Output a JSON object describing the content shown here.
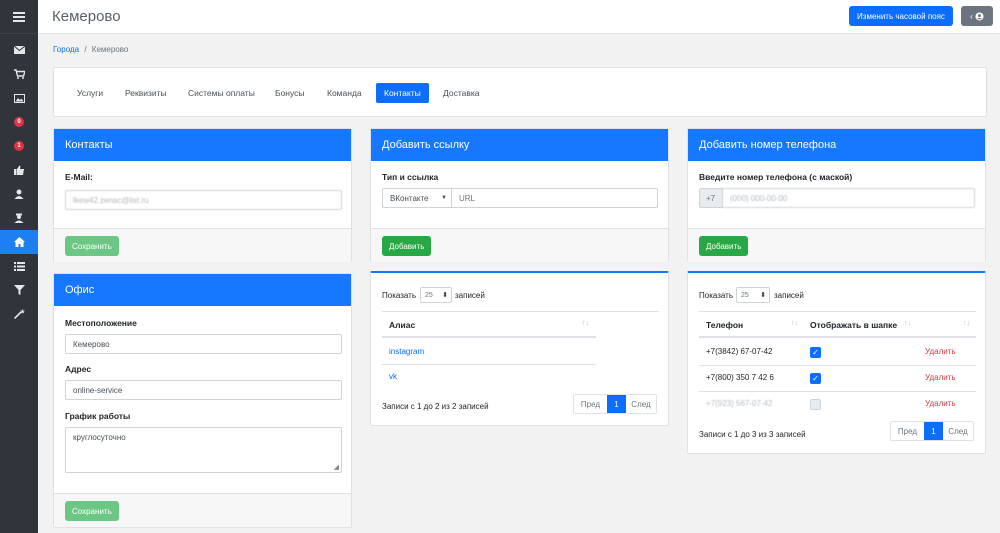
{
  "header": {
    "title": "Кемерово",
    "timezone_button": "Изменить часовой пояс",
    "back_glyph": "‹",
    "user_icon": "user-circle-icon"
  },
  "breadcrumb": {
    "cities": "Города",
    "separator": "/",
    "current": "Кемерово"
  },
  "tabs": [
    "Услуги",
    "Реквизиты",
    "Системы оплаты",
    "Бонусы",
    "Команда",
    "Контакты",
    "Доставка"
  ],
  "active_tab": "Контакты",
  "sidebar": {
    "items": [
      "envelope-icon",
      "cart-icon",
      "image-icon",
      "badge",
      "badge",
      "thumbs-up-icon",
      "user-icon",
      "user-secret-icon",
      "home-icon",
      "list-icon",
      "filter-icon",
      "wand-icon"
    ],
    "badges": [
      "0",
      "1"
    ]
  },
  "contacts": {
    "title": "Контакты",
    "email_label": "E-Mail:",
    "email_value": "lkew42.zenac@list.ru",
    "save": "Сохранить"
  },
  "office": {
    "title": "Офис",
    "location_label": "Местоположение",
    "location_value": "Кемерово",
    "address_label": "Адрес",
    "address_value": "online-service",
    "schedule_label": "График работы",
    "schedule_value": "круглосуточно",
    "save": "Сохранить"
  },
  "add_link": {
    "title": "Добавить ссылку",
    "type_label": "Тип и ссылка",
    "type_value": "ВКонтакте",
    "url_placeholder": "URL",
    "add": "Добавить"
  },
  "links_table": {
    "show": "Показать",
    "per_page": "25",
    "records": "записей",
    "column": "Алиас",
    "rows": [
      "instagram",
      "vk"
    ],
    "info": "Записи с 1 до 2 из 2 записей",
    "prev": "Пред",
    "page": "1",
    "next": "След"
  },
  "add_phone": {
    "title": "Добавить номер телефона",
    "label": "Введите номер телефона (с маской)",
    "prefix": "+7",
    "placeholder": "(000) 000-00-00",
    "add": "Добавить"
  },
  "phones_table": {
    "show": "Показать",
    "per_page": "25",
    "records": "записей",
    "col_phone": "Телефон",
    "col_show": "Отображать в шапке",
    "rows": [
      {
        "phone": "+7(3842) 67-07-42",
        "checked": true,
        "action": "Удалить"
      },
      {
        "phone": "+7(800) 350 7 42 6",
        "checked": true,
        "action": "Удалить"
      },
      {
        "phone": "+7(923) 567-07-42",
        "checked": false,
        "action": "Удалить"
      }
    ],
    "info": "Записи с 1 до 3 из 3 записей",
    "prev": "Пред",
    "page": "1",
    "next": "След"
  }
}
